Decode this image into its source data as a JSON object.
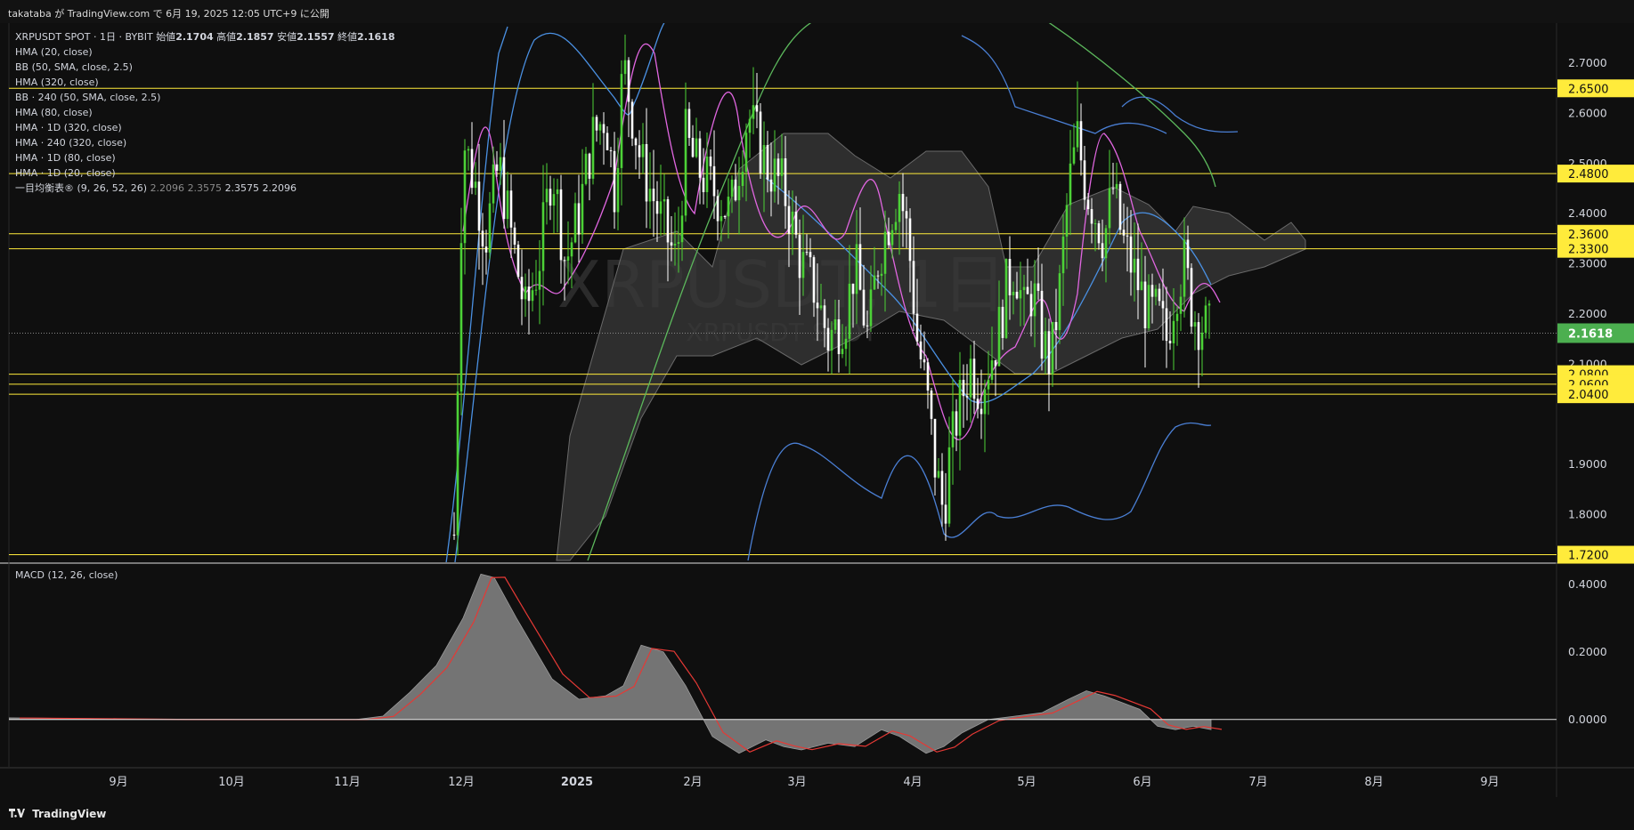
{
  "header": {
    "publish_line": "takataba が TradingView.com で 6月 19, 2025 12:05 UTC+9 に公開"
  },
  "legend": {
    "symbol_line": "XRPUSDT SPOT · 1日 · BYBIT",
    "open_label": "始値",
    "open": "2.1704",
    "high_label": "高値",
    "high": "2.1857",
    "low_label": "安値",
    "low": "2.1557",
    "close_label": "終値",
    "close": "2.1618",
    "indicators": [
      "HMA (20, close)",
      "BB (50, SMA, close, 2.5)",
      "HMA (320, close)",
      "BB · 240 (50, SMA, close, 2.5)",
      "HMA (80, close)",
      "HMA · 1D (320, close)",
      "HMA · 240 (320, close)",
      "HMA · 1D (80, close)",
      "HMA · 1D (20, close)"
    ],
    "ichimoku_label": "一目均衡表® (9, 26, 52, 26)",
    "ichimoku_values": [
      "2.2096",
      "2.3575",
      "2.3575",
      "2.2096"
    ]
  },
  "watermark": {
    "big": "XRPUSDT, 1日",
    "small": "XRPUSDT SPOT"
  },
  "price_axis": {
    "ticks": [
      "2.7000",
      "2.6000",
      "2.5000",
      "2.4000",
      "2.3000",
      "2.2000",
      "2.1000",
      "1.9000",
      "1.8000"
    ],
    "tick_values": [
      2.7,
      2.6,
      2.5,
      2.4,
      2.3,
      2.2,
      2.1,
      1.9,
      1.8
    ],
    "ylim": [
      1.705,
      2.78
    ],
    "current_price": "2.1618",
    "current_value": 2.1618,
    "current_color": "#4caf50"
  },
  "horizontal_levels": [
    {
      "label": "2.6500",
      "value": 2.65
    },
    {
      "label": "2.4800",
      "value": 2.48
    },
    {
      "label": "2.3600",
      "value": 2.36
    },
    {
      "label": "2.3300",
      "value": 2.33
    },
    {
      "label": "2.0800",
      "value": 2.08
    },
    {
      "label": "2.0600",
      "value": 2.06
    },
    {
      "label": "2.0400",
      "value": 2.04
    },
    {
      "label": "1.7200",
      "value": 1.72
    }
  ],
  "level_color": "#ffeb3b",
  "macd": {
    "label": "MACD (12, 26, close)",
    "ticks": [
      "0.4000",
      "0.2000",
      "0.0000"
    ],
    "tick_values": [
      0.4,
      0.2,
      0.0
    ],
    "ylim": [
      -0.14,
      0.46
    ]
  },
  "time_axis": {
    "labels": [
      "9月",
      "10月",
      "11月",
      "12月",
      "2025",
      "2月",
      "3月",
      "4月",
      "5月",
      "6月",
      "7月",
      "8月",
      "9月"
    ]
  },
  "footer": {
    "brand": "TradingView"
  },
  "colors": {
    "background": "#0f0f0f",
    "candle_up": "#4cd137",
    "candle_down": "#ffffff",
    "hma20": "#e066e0",
    "hma_blue": "#4a90e2",
    "hma_green": "#5cb85c",
    "bb": "#4a7fd4",
    "cloud": "#3a3a3a",
    "macd_hist": "#7a7a7a",
    "macd_signal": "#e53935"
  }
}
